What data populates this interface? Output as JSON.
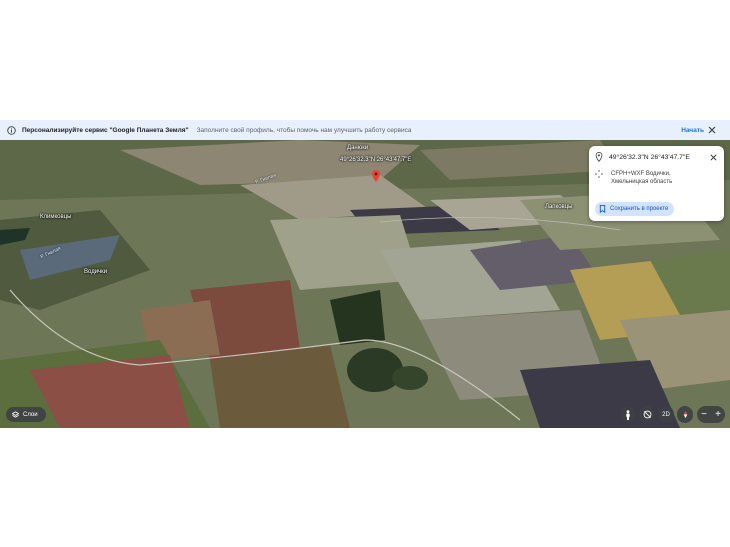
{
  "banner": {
    "title": "Персонализируйте сервис \"Google Планета Земля\"",
    "subtitle": "Заполните свой профиль, чтобы помочь нам улучшить работу сервиса",
    "start": "Начать",
    "icon": "info-icon",
    "close_icon": "close-icon"
  },
  "map": {
    "places": [
      "Данюки",
      "Климковцы",
      "Водички",
      "Лапковцы"
    ],
    "rivers": [
      "Р. Гнилая",
      "Р. Гнилая"
    ],
    "pin_label": "49°26'32.3\"N 26°43'47.7\"E",
    "pin_color": "#ea4335"
  },
  "info_card": {
    "coords": "49°26'32.3\"N 26°43'47.7\"E",
    "plus_code": "CFРН+WXF Водички, Хмельницкая область",
    "save_button": "Сохранить в проекте"
  },
  "controls": {
    "layers": "Слои",
    "view_2d": "2D",
    "zoom_out": "−",
    "zoom_in": "+"
  }
}
